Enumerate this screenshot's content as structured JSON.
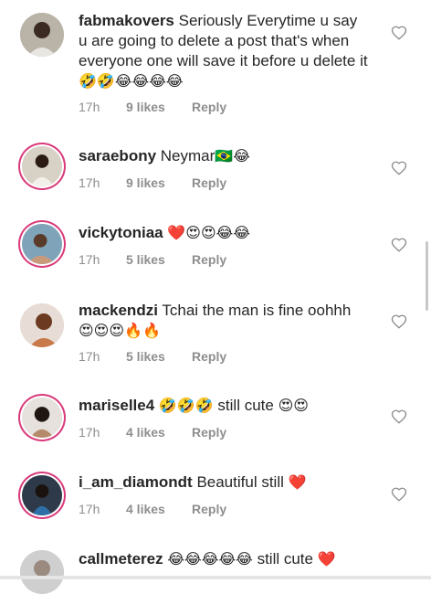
{
  "comments": [
    {
      "username": "fabmakovers",
      "text": "Seriously Everytime u say u are going to delete a post that's when everyone one will save it before u delete it",
      "emojis": "🤣🤣😂😂😂😂",
      "time": "17h",
      "likes": "9 likes",
      "reply": "Reply",
      "story_ring": false
    },
    {
      "username": "saraebony",
      "text": "Neymar",
      "emojis": "🇧🇷😂",
      "time": "17h",
      "likes": "9 likes",
      "reply": "Reply",
      "story_ring": true
    },
    {
      "username": "vickytoniaa",
      "text": "",
      "emojis": "❤️😍😍😂😂",
      "time": "17h",
      "likes": "5 likes",
      "reply": "Reply",
      "story_ring": true
    },
    {
      "username": "mackendzi",
      "text": "Tchai  the man is fine oohhh",
      "emojis": "😍😍😍🔥🔥",
      "time": "17h",
      "likes": "5 likes",
      "reply": "Reply",
      "story_ring": false
    },
    {
      "username": "mariselle4",
      "text": "still cute",
      "emojis_before": "🤣🤣🤣",
      "emojis": "😍😍",
      "time": "17h",
      "likes": "4 likes",
      "reply": "Reply",
      "story_ring": true
    },
    {
      "username": "i_am_diamondt",
      "text": "Beautiful still",
      "emojis": "❤️",
      "time": "17h",
      "likes": "4 likes",
      "reply": "Reply",
      "story_ring": true
    },
    {
      "username": "callmeterez",
      "text": "still cute",
      "emojis_before": "😂😂😂😂😂",
      "emojis": "❤️",
      "story_ring": false
    }
  ],
  "icons": {
    "like": "heart-outline-icon"
  },
  "colors": {
    "story_ring": "#d93a7a",
    "meta_text": "#8e8e8e",
    "text": "#262626"
  }
}
